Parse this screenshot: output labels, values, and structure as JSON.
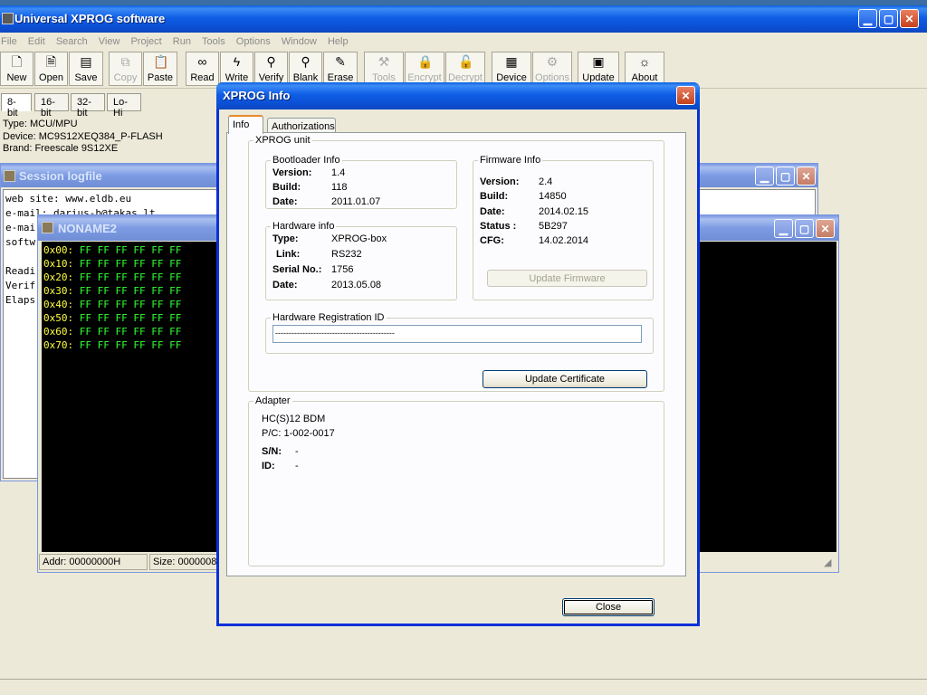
{
  "main_window": {
    "title": "Universal XPROG software",
    "menu": [
      "File",
      "Edit",
      "Search",
      "View",
      "Project",
      "Run",
      "Tools",
      "Options",
      "Window",
      "Help"
    ],
    "toolbar": [
      {
        "label": "New",
        "icon": "new-file-icon",
        "enabled": true
      },
      {
        "label": "Open",
        "icon": "open-file-icon",
        "enabled": true
      },
      {
        "label": "Save",
        "icon": "save-icon",
        "enabled": true
      },
      {
        "label": "Copy",
        "icon": "copy-icon",
        "enabled": false
      },
      {
        "label": "Paste",
        "icon": "paste-icon",
        "enabled": true
      },
      {
        "label": "Read",
        "icon": "read-glasses-icon",
        "enabled": true
      },
      {
        "label": "Write",
        "icon": "write-lightning-icon",
        "enabled": true
      },
      {
        "label": "Verify",
        "icon": "verify-magnifier-icon",
        "enabled": true
      },
      {
        "label": "Blank",
        "icon": "blank-magnifier-icon",
        "enabled": true
      },
      {
        "label": "Erase",
        "icon": "erase-icon",
        "enabled": true
      },
      {
        "label": "Tools",
        "icon": "tools-icon",
        "enabled": false
      },
      {
        "label": "Encrypt",
        "icon": "lock-icon",
        "enabled": false
      },
      {
        "label": "Decrypt",
        "icon": "unlock-icon",
        "enabled": false
      },
      {
        "label": "Device",
        "icon": "chip-icon",
        "enabled": true
      },
      {
        "label": "Options",
        "icon": "options-icon",
        "enabled": false
      },
      {
        "label": "Update",
        "icon": "update-icon",
        "enabled": true
      },
      {
        "label": "About",
        "icon": "about-icon",
        "enabled": true
      }
    ],
    "bit_tabs": [
      "8-bit",
      "16-bit",
      "32-bit",
      "Lo-Hi"
    ],
    "device_info": [
      "Type: MCU/MPU",
      "Device: MC9S12XEQ384_P-FLASH",
      "Brand: Freescale 9S12XE"
    ]
  },
  "session_log": {
    "title": "Session logfile",
    "lines": [
      "web site: www.eldb.eu",
      "e-mail: darius-b@takas.lt",
      "e-mai",
      "softw",
      "",
      "Readi",
      "Verif",
      "Elaps"
    ]
  },
  "hex_window": {
    "title": "NONAME2",
    "rows": [
      {
        "addr": "0x00:",
        "bytes": "FF FF FF FF FF FF"
      },
      {
        "addr": "0x10:",
        "bytes": "FF FF FF FF FF FF"
      },
      {
        "addr": "0x20:",
        "bytes": "FF FF FF FF FF FF"
      },
      {
        "addr": "0x30:",
        "bytes": "FF FF FF FF FF FF"
      },
      {
        "addr": "0x40:",
        "bytes": "FF FF FF FF FF FF"
      },
      {
        "addr": "0x50:",
        "bytes": "FF FF FF FF FF FF"
      },
      {
        "addr": "0x60:",
        "bytes": "FF FF FF FF FF FF"
      },
      {
        "addr": "0x70:",
        "bytes": "FF FF FF FF FF FF"
      }
    ],
    "status_addr": "Addr: 00000000H",
    "status_size": "Size: 00000080"
  },
  "dialog": {
    "title": "XPROG Info",
    "tabs": [
      "Info",
      "Authorizations"
    ],
    "xprog_unit": {
      "label": "XPROG unit",
      "bootloader": {
        "label": "Bootloader Info",
        "version_label": "Version:",
        "version": "1.4",
        "build_label": "Build:",
        "build": "118",
        "date_label": "Date:",
        "date": "2011.01.07"
      },
      "hardware": {
        "label": "Hardware info",
        "type_label": "Type:",
        "type": "XPROG-box",
        "link_label": "Link:",
        "link": "RS232",
        "serial_label": "Serial No.:",
        "serial": "1756",
        "date_label": "Date:",
        "date": "2013.05.08"
      },
      "firmware": {
        "label": "Firmware Info",
        "version_label": "Version:",
        "version": "2.4",
        "build_label": "Build:",
        "build": "14850",
        "date_label": "Date:",
        "date": "2014.02.15",
        "status_label": "Status :",
        "status": "5B297",
        "cfg_label": "CFG:",
        "cfg": "14.02.2014",
        "update_button": "Update Firmware"
      },
      "registration": {
        "label": "Hardware Registration ID",
        "value": "--------------------------------------------"
      },
      "update_certificate_button": "Update Certificate"
    },
    "adapter": {
      "label": "Adapter",
      "name": "HC(S)12 BDM",
      "pc": "P/C: 1-002-0017",
      "sn_label": "S/N:",
      "sn": "-",
      "id_label": "ID:",
      "id": "-"
    },
    "close_button": "Close"
  }
}
